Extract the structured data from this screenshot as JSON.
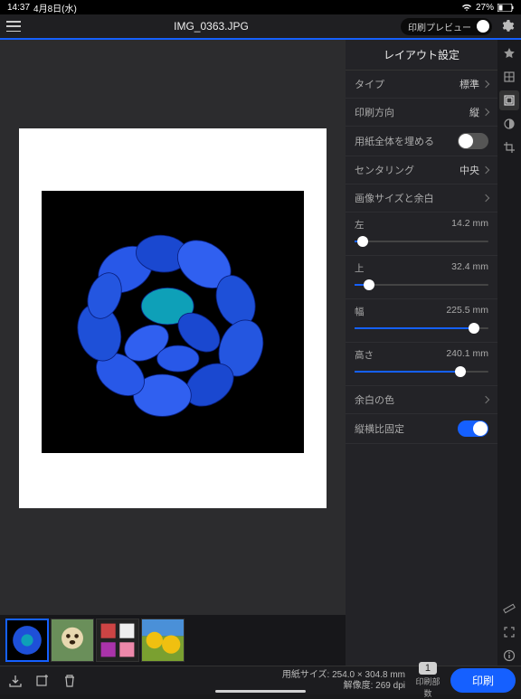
{
  "status": {
    "time": "14:37",
    "date": "4月8日(水)",
    "battery": "27%"
  },
  "header": {
    "filename": "IMG_0363.JPG",
    "preview_label": "印刷プレビュー"
  },
  "panel": {
    "title": "レイアウト設定",
    "type_label": "タイプ",
    "type_value": "標準",
    "orient_label": "印刷方向",
    "orient_value": "縦",
    "fill_label": "用紙全体を埋める",
    "center_label": "センタリング",
    "center_value": "中央",
    "size_margin_label": "画像サイズと余白",
    "left_label": "左",
    "left_value": "14.2 mm",
    "top_label": "上",
    "top_value": "32.4 mm",
    "width_label": "幅",
    "width_value": "225.5 mm",
    "height_label": "高さ",
    "height_value": "240.1 mm",
    "margin_color_label": "余白の色",
    "aspect_lock_label": "縦横比固定"
  },
  "bottom": {
    "paper_label": "用紙サイズ:",
    "paper_value": "254.0 × 304.8 mm",
    "res_label": "解像度:",
    "res_value": "269 dpi",
    "copies": "1",
    "copies_label": "印刷部数",
    "print_label": "印刷"
  }
}
